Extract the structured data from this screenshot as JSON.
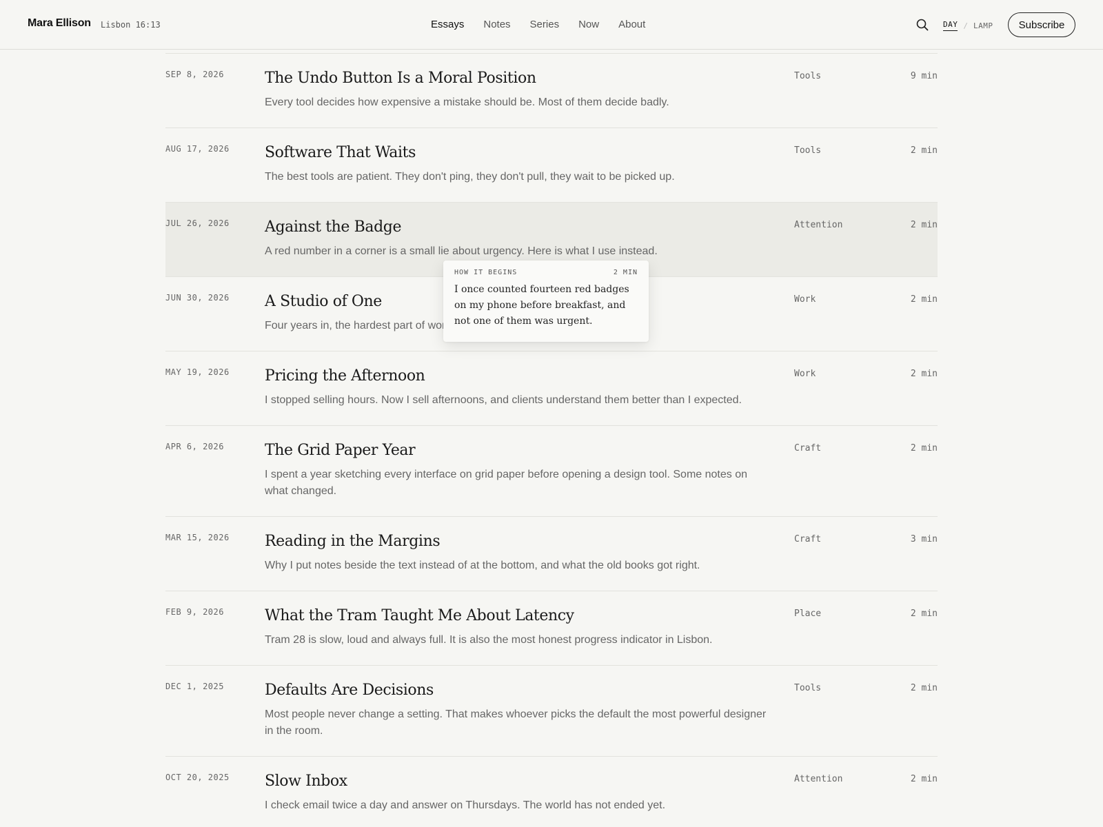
{
  "header": {
    "brand": "Mara Ellison",
    "clock": "Lisbon 16:13",
    "nav": [
      "Essays",
      "Notes",
      "Series",
      "Now",
      "About"
    ],
    "active_nav": "Essays",
    "search_icon": "search-icon",
    "mode": {
      "day": "DAY",
      "separator": "/",
      "lamp": "LAMP"
    },
    "subscribe": "Subscribe"
  },
  "essays": [
    {
      "date": "SEP 8, 2026",
      "title": "The Undo Button Is a Moral Position",
      "excerpt": "Every tool decides how expensive a mistake should be. Most of them decide badly.",
      "tag": "Tools",
      "read_time": "9 min"
    },
    {
      "date": "AUG 17, 2026",
      "title": "Software That Waits",
      "excerpt": "The best tools are patient. They don't ping, they don't pull, they wait to be picked up.",
      "tag": "Tools",
      "read_time": "2 min"
    },
    {
      "date": "JUL 26, 2026",
      "title": "Against the Badge",
      "excerpt": "A red number in a corner is a small lie about urgency. Here is what I use instead.",
      "tag": "Attention",
      "read_time": "2 min",
      "hovered": true
    },
    {
      "date": "JUN 30, 2026",
      "title": "A Studio of One",
      "excerpt": "Four years in, the hardest part of working alone is deciding what the work is.",
      "tag": "Work",
      "read_time": "2 min"
    },
    {
      "date": "MAY 19, 2026",
      "title": "Pricing the Afternoon",
      "excerpt": "I stopped selling hours. Now I sell afternoons, and clients understand them better than I expected.",
      "tag": "Work",
      "read_time": "2 min"
    },
    {
      "date": "APR 6, 2026",
      "title": "The Grid Paper Year",
      "excerpt": "I spent a year sketching every interface on grid paper before opening a design tool. Some notes on what changed.",
      "tag": "Craft",
      "read_time": "2 min"
    },
    {
      "date": "MAR 15, 2026",
      "title": "Reading in the Margins",
      "excerpt": "Why I put notes beside the text instead of at the bottom, and what the old books got right.",
      "tag": "Craft",
      "read_time": "3 min"
    },
    {
      "date": "FEB 9, 2026",
      "title": "What the Tram Taught Me About Latency",
      "excerpt": "Tram 28 is slow, loud and always full. It is also the most honest progress indicator in Lisbon.",
      "tag": "Place",
      "read_time": "2 min"
    },
    {
      "date": "DEC 1, 2025",
      "title": "Defaults Are Decisions",
      "excerpt": "Most people never change a setting. That makes whoever picks the default the most powerful designer in the room.",
      "tag": "Tools",
      "read_time": "2 min"
    },
    {
      "date": "OCT 20, 2025",
      "title": "Slow Inbox",
      "excerpt": "I check email twice a day and answer on Thursdays. The world has not ended yet.",
      "tag": "Attention",
      "read_time": "2 min"
    }
  ],
  "preview": {
    "label": "HOW IT BEGINS",
    "read_time": "2 MIN",
    "text": "I once counted fourteen red badges on my phone before breakfast, and not one of them was urgent."
  },
  "colors": {
    "background": "#f6f6f3",
    "hover_row": "#ebebe6",
    "text": "#1c1c1c",
    "muted": "#666666"
  }
}
